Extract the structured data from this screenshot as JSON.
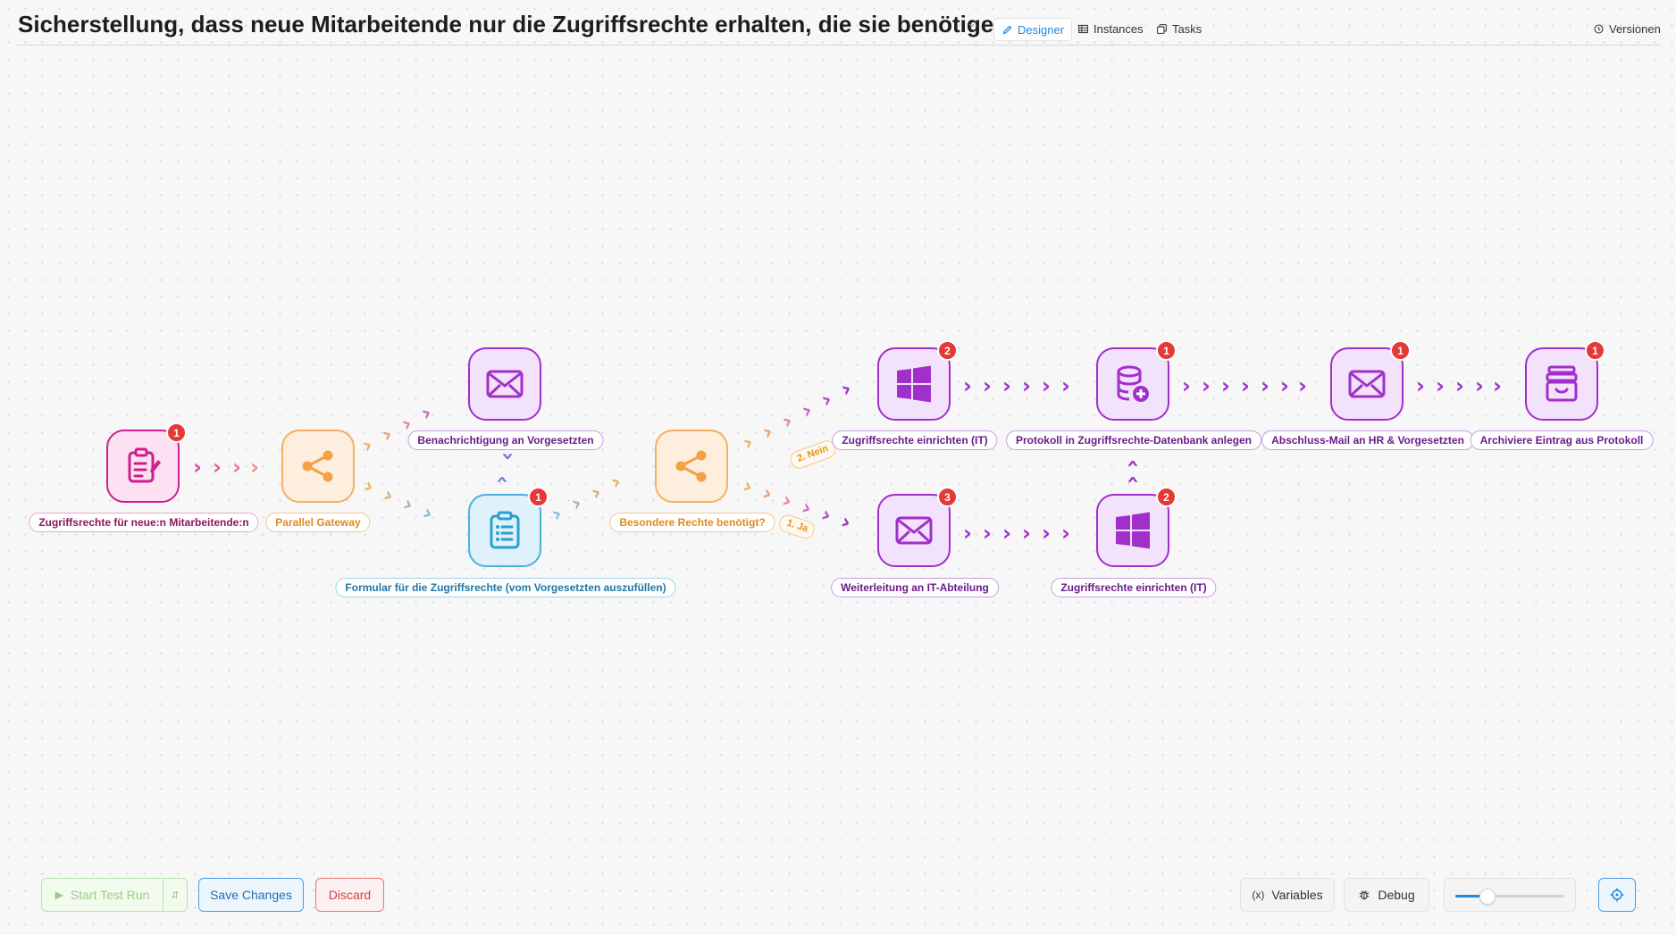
{
  "header": {
    "title": "Sicherstellung, dass neue Mitarbeitende nur die Zugriffsrechte erhalten, die sie benötigen",
    "tabs": [
      "Designer",
      "Instances",
      "Tasks"
    ],
    "versions_label": "Versionen"
  },
  "nodes": {
    "start_form": {
      "label": "Zugriffsrechte für neue:n Mitarbeitende:n",
      "badge": "1",
      "icon": "form-edit-icon"
    },
    "parallel_gateway": {
      "label": "Parallel Gateway",
      "icon": "share-icon"
    },
    "notify_manager": {
      "label": "Benachrichtigung an Vorgesetzten",
      "icon": "mail-icon"
    },
    "manager_form": {
      "label": "Formular für die Zugriffsrechte (vom Vorgesetzten auszufüllen)",
      "badge": "1",
      "icon": "clipboard-list-icon"
    },
    "special_rights_gateway": {
      "label": "Besondere Rechte benötigt?",
      "icon": "share-icon"
    },
    "setup_rights_top": {
      "label": "Zugriffsrechte einrichten (IT)",
      "badge": "2",
      "icon": "windows-icon"
    },
    "forward_it": {
      "label": "Weiterleitung an IT-Abteilung",
      "badge": "3",
      "icon": "mail-icon"
    },
    "setup_rights_bottom": {
      "label": "Zugriffsrechte einrichten (IT)",
      "badge": "2",
      "icon": "windows-icon"
    },
    "log_db": {
      "label": "Protokoll in Zugriffsrechte-Datenbank anlegen",
      "badge": "1",
      "icon": "database-add-icon"
    },
    "final_mail": {
      "label": "Abschluss-Mail an HR & Vorgesetzten",
      "badge": "1",
      "icon": "mail-icon"
    },
    "archive": {
      "label": "Archiviere Eintrag aus Protokoll",
      "badge": "1",
      "icon": "archive-icon"
    }
  },
  "branches": {
    "no": "2. Nein",
    "yes": "1. Ja"
  },
  "footer": {
    "start_test_run": "Start Test Run",
    "save_changes": "Save Changes",
    "discard": "Discard",
    "variables": "Variables",
    "variables_prefix": "(x)",
    "debug": "Debug",
    "zoom_level": 0.28
  },
  "colors": {
    "purple": "#a12fc9",
    "pink": "#cf1f8f",
    "orange": "#f5b060",
    "blue": "#4ab1de",
    "badge": "#e53935",
    "accent": "#1e88e5"
  }
}
